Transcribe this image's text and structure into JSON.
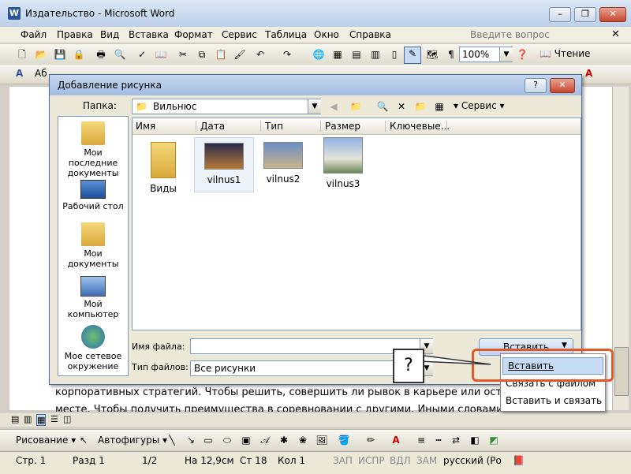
{
  "window": {
    "title": "Издательство - Microsoft Word",
    "app_letter": "W"
  },
  "menu": {
    "items": [
      "Файл",
      "Правка",
      "Вид",
      "Вставка",
      "Формат",
      "Сервис",
      "Таблица",
      "Окно",
      "Справка"
    ],
    "ask_placeholder": "Введите вопрос"
  },
  "toolbar": {
    "zoom": "100%",
    "reading": "Чтение",
    "style_label": "Аб"
  },
  "doc": {
    "line1": "корпоративных стратегий. Чтобы решить, совершить ли рывок в карьере или остат",
    "line2": "месте. Чтобы получить преимущества в соревновании с другими. Иными словами, в издатель"
  },
  "dialog": {
    "title": "Добавление рисунка",
    "folder_label": "Папка:",
    "folder_value": "Вильнюс",
    "service": "Сервис",
    "places": [
      "Мои последние документы",
      "Рабочий стол",
      "Мои документы",
      "Мой компьютер",
      "Мое сетевое окружение"
    ],
    "columns": [
      "Имя",
      "Дата",
      "Тип",
      "Размер",
      "Ключевые..."
    ],
    "files": [
      "Виды",
      "vilnus1",
      "vilnus2",
      "vilnus3"
    ],
    "filename_label": "Имя файла:",
    "filename_value": "",
    "filetype_label": "Тип файлов:",
    "filetype_value": "Все рисунки",
    "insert_button": "Вставить",
    "help": "?",
    "close": "✕"
  },
  "insert_menu": [
    "Вставить",
    "Связать с файлом",
    "Вставить и связать"
  ],
  "callout": "?",
  "drawing": {
    "draw": "Рисование",
    "autoshapes": "Автофигуры"
  },
  "status": {
    "page": "Стр. 1",
    "section": "Разд 1",
    "pages": "1/2",
    "at": "На 12,9см",
    "line": "Ст 18",
    "col": "Кол 1",
    "rec": "ЗАП",
    "trk": "ИСПР",
    "ext": "ВДЛ",
    "ovr": "ЗАМ",
    "lang": "русский (Ро"
  },
  "colors": {
    "accent_highlight": "#e0582b",
    "selection": "#c7dcf4"
  }
}
